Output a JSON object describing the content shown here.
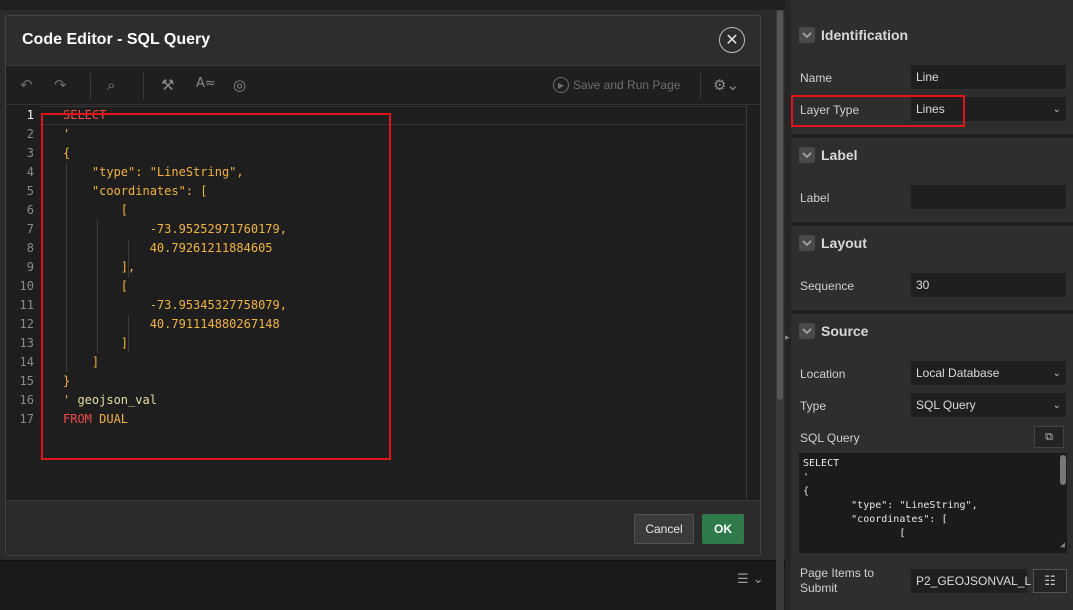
{
  "modal": {
    "title": "Code Editor - SQL Query",
    "toolbar": {
      "save_run_label": "Save and Run Page"
    },
    "line_numbers": [
      "1",
      "2",
      "3",
      "4",
      "5",
      "6",
      "7",
      "8",
      "9",
      "10",
      "11",
      "12",
      "13",
      "14",
      "15",
      "16",
      "17"
    ],
    "code": [
      [
        {
          "t": "SELECT",
          "c": "kw"
        }
      ],
      [
        {
          "t": "'",
          "c": "str"
        }
      ],
      [
        {
          "t": "{",
          "c": "str"
        }
      ],
      [
        {
          "t": "    \"type\": \"LineString\",",
          "c": "str"
        }
      ],
      [
        {
          "t": "    \"coordinates\": [",
          "c": "str"
        }
      ],
      [
        {
          "t": "        [",
          "c": "str"
        }
      ],
      [
        {
          "t": "            -73.95252971760179,",
          "c": "str"
        }
      ],
      [
        {
          "t": "            40.79261211884605",
          "c": "str"
        }
      ],
      [
        {
          "t": "        ],",
          "c": "str"
        }
      ],
      [
        {
          "t": "        [",
          "c": "str"
        }
      ],
      [
        {
          "t": "            -73.95345327758079,",
          "c": "str"
        }
      ],
      [
        {
          "t": "            40.791114880267148",
          "c": "str"
        }
      ],
      [
        {
          "t": "        ]",
          "c": "str"
        }
      ],
      [
        {
          "t": "    ]",
          "c": "str"
        }
      ],
      [
        {
          "t": "}",
          "c": "str"
        }
      ],
      [
        {
          "t": "' ",
          "c": "str"
        },
        {
          "t": "geojson_val",
          "c": "id"
        }
      ],
      [
        {
          "t": "FROM ",
          "c": "kw"
        },
        {
          "t": "DUAL",
          "c": "str"
        }
      ]
    ],
    "footer": {
      "cancel_label": "Cancel",
      "ok_label": "OK"
    }
  },
  "property_panel": {
    "identification": {
      "title": "Identification",
      "name_label": "Name",
      "name_value": "Line",
      "layer_type_label": "Layer Type",
      "layer_type_value": "Lines"
    },
    "label_section": {
      "title": "Label",
      "label_label": "Label",
      "label_value": ""
    },
    "layout": {
      "title": "Layout",
      "sequence_label": "Sequence",
      "sequence_value": "30"
    },
    "source": {
      "title": "Source",
      "location_label": "Location",
      "location_value": "Local Database",
      "type_label": "Type",
      "type_value": "SQL Query",
      "sql_query_label": "SQL Query",
      "sql_preview": "SELECT\n'\n{\n        \"type\": \"LineString\",\n        \"coordinates\": [\n                [",
      "page_items_label": "Page Items to Submit",
      "page_items_value": "P2_GEOJSONVAL_L"
    }
  },
  "colors": {
    "highlight_border": "#e0141a",
    "ok_button": "#2f7a4a",
    "keyword": "#f04a4a",
    "string": "#f2b43c"
  }
}
